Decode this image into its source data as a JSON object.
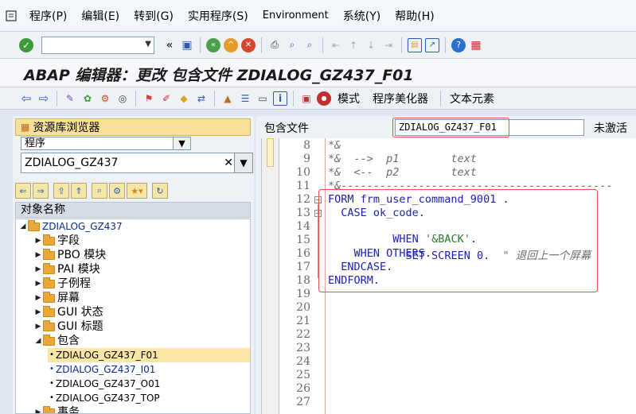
{
  "menu": {
    "items": [
      "程序(P)",
      "编辑(E)",
      "转到(G)",
      "实用程序(S)",
      "Environment",
      "系统(Y)",
      "帮助(H)"
    ]
  },
  "stdbar": {
    "command_value": "",
    "icons": [
      "enter-icon",
      "save-icon",
      "back-icon",
      "exit-icon",
      "cancel-icon",
      "print-icon",
      "find-icon",
      "find-next-icon",
      "first-page-icon",
      "prev-page-icon",
      "next-page-icon",
      "last-page-icon",
      "new-session-icon",
      "shortcut-icon",
      "help-icon",
      "layout-icon"
    ]
  },
  "title": "ABAP 编辑器：更改 包含文件 ZDIALOG_GZ437_F01",
  "appbar": {
    "buttons": [
      "模式",
      "程序美化器",
      "文本元素"
    ]
  },
  "browser": {
    "header": "资源库浏览器",
    "object_type": "程序",
    "object_name": "ZDIALOG_GZ437",
    "tree_header": "对象名称",
    "root": "ZDIALOG_GZ437",
    "nodes": [
      "字段",
      "PBO 模块",
      "PAI 模块",
      "子例程",
      "屏幕",
      "GUI 状态",
      "GUI 标题",
      "包含"
    ],
    "includes": [
      "ZDIALOG_GZ437_F01",
      "ZDIALOG_GZ437_I01",
      "ZDIALOG_GZ437_O01",
      "ZDIALOG_GZ437_TOP"
    ],
    "last_node": "事务"
  },
  "editor": {
    "include_label": "包含文件",
    "include_name": "ZDIALOG_GZ437_F01",
    "status": "未激活",
    "line_numbers": [
      "8",
      "9",
      "10",
      "11",
      "12",
      "13",
      "14",
      "15",
      "16",
      "17",
      "18",
      "19",
      "20",
      "21",
      "22",
      "23",
      "24",
      "25",
      "26",
      "27"
    ],
    "code": {
      "l8": "*&",
      "l9a": "*&  -->  p1        text",
      "l10a": "*&  <--  p2        text",
      "l11": "*&------------------------------------------",
      "l12": "FORM frm_user_command_9001 .",
      "l13": "  CASE ok_code.",
      "l14_kw": "    WHEN ",
      "l14_str": "'&BACK'",
      "l14_end": ".",
      "l15": "      SET SCREEN 0.",
      "l15_cmt": "  \" 退回上一个屏幕",
      "l16": "    WHEN OTHERS.",
      "l17": "  ENDCASE.",
      "l18": "ENDFORM."
    }
  }
}
